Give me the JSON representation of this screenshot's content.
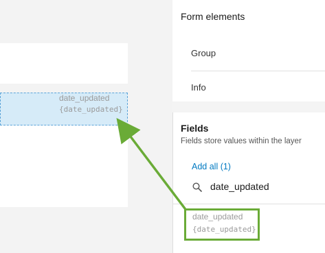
{
  "canvas": {
    "selected_field": {
      "name": "date_updated",
      "value": "{date_updated}"
    }
  },
  "panel": {
    "form_elements": {
      "title": "Form elements",
      "items": [
        "Group",
        "Info"
      ]
    },
    "fields": {
      "title": "Fields",
      "description": "Fields store values within the layer",
      "add_all_label": "Add all (1)",
      "search_value": "date_updated",
      "search_icon": "search-icon",
      "items": [
        {
          "name": "date_updated",
          "value": "{date_updated}"
        }
      ]
    }
  },
  "annotation": {
    "highlight_color": "#6aab37",
    "arrow_color": "#6aab37"
  }
}
